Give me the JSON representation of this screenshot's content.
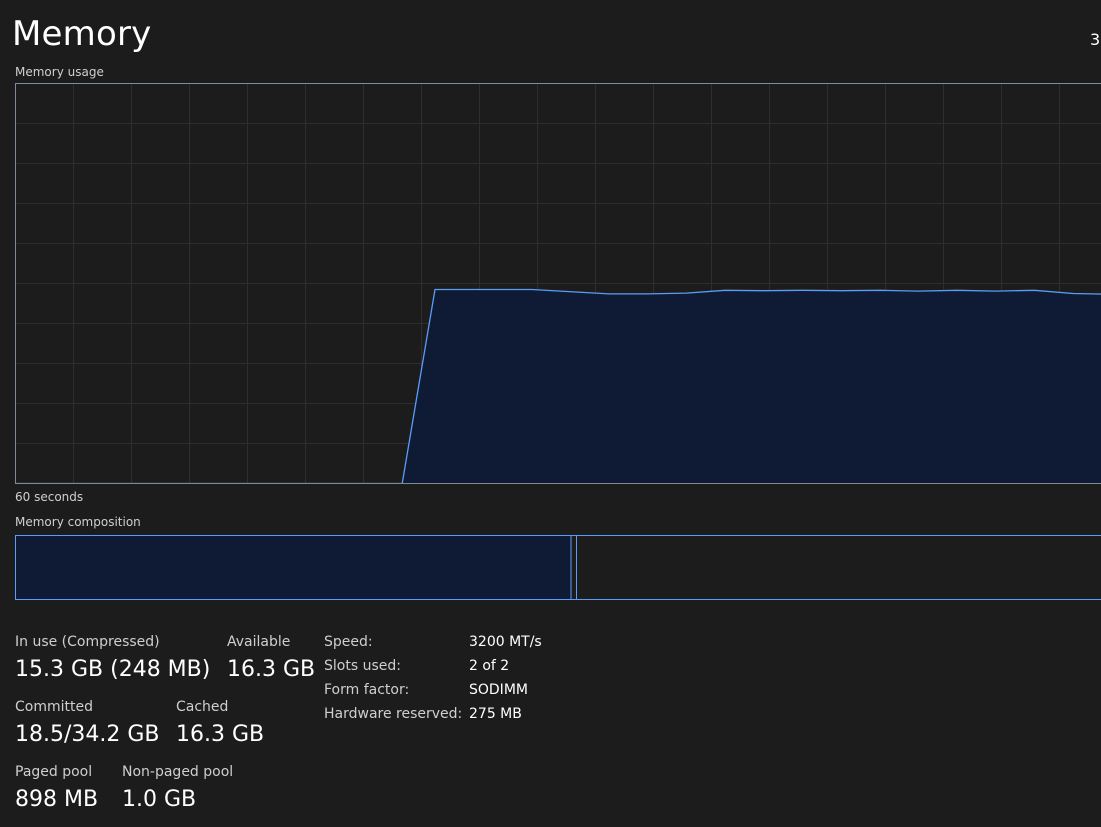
{
  "header": {
    "title": "Memory",
    "total_truncated": "3"
  },
  "usage_graph": {
    "label": "Memory usage",
    "time_span_label": "60 seconds"
  },
  "composition": {
    "label": "Memory composition",
    "in_use_fraction": 0.505,
    "modified_fraction": 0.005
  },
  "stats": {
    "in_use": {
      "label": "In use (Compressed)",
      "value": "15.3 GB (248 MB)"
    },
    "available": {
      "label": "Available",
      "value": "16.3 GB"
    },
    "committed": {
      "label": "Committed",
      "value": "18.5/34.2 GB"
    },
    "cached": {
      "label": "Cached",
      "value": "16.3 GB"
    },
    "paged_pool": {
      "label": "Paged pool",
      "value": "898 MB"
    },
    "non_paged_pool": {
      "label": "Non-paged pool",
      "value": "1.0 GB"
    }
  },
  "specs": {
    "speed": {
      "label": "Speed:",
      "value": "3200 MT/s"
    },
    "slots": {
      "label": "Slots used:",
      "value": "2 of 2"
    },
    "form_factor": {
      "label": "Form factor:",
      "value": "SODIMM"
    },
    "hw_reserved": {
      "label": "Hardware reserved:",
      "value": "275 MB"
    }
  },
  "chart_data": {
    "type": "area",
    "x": [
      0,
      20,
      21.7,
      25.7,
      26.7,
      30.7,
      32.7,
      34.7,
      36.7,
      38.7,
      40.7,
      42.7,
      44.7,
      46.7,
      48.7,
      50.7,
      52.7,
      54.7,
      56.7,
      58.7,
      60
    ],
    "values": [
      0,
      0,
      48.5,
      48.5,
      48.5,
      47.4,
      47.4,
      47.6,
      48.3,
      48.2,
      48.3,
      48.2,
      48.3,
      48.1,
      48.3,
      48.1,
      48.3,
      47.5,
      47.3,
      47.3,
      47.3
    ],
    "xlim": [
      0,
      60
    ],
    "ylim": [
      0,
      100
    ],
    "grid": true,
    "line_color": "#5b9cf6",
    "fill_color": "#0f1b35",
    "grid_color": "#2e2e2e",
    "border_color": "#7e8a9a"
  }
}
